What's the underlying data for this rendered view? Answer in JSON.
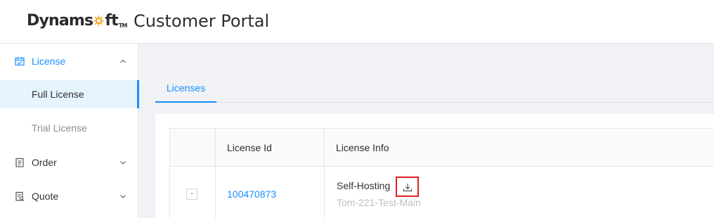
{
  "header": {
    "logo_text_before": "Dynam",
    "logo_text_after": "s",
    "logo_text_end": "ft",
    "logo_tm": "TM",
    "portal_title": "Customer Portal"
  },
  "sidebar": {
    "items": [
      {
        "label": "License",
        "icon": "license-icon",
        "expanded": true
      },
      {
        "label": "Full License",
        "selected": true
      },
      {
        "label": "Trial License"
      },
      {
        "label": "Order",
        "icon": "order-icon",
        "expanded": false
      },
      {
        "label": "Quote",
        "icon": "quote-icon",
        "expanded": false
      }
    ]
  },
  "tabs": [
    {
      "label": "Licenses",
      "active": true
    }
  ],
  "table": {
    "headers": [
      "",
      "License Id",
      "License Info"
    ],
    "rows": [
      {
        "expand_symbol": "-",
        "license_id": "100470873",
        "license_type": "Self-Hosting",
        "license_name": "Tom-221-Test-Main",
        "action_icon": "download-icon"
      }
    ]
  },
  "colors": {
    "accent": "#1890ff",
    "highlight_box": "#e02020",
    "logo_orange": "#f39c12"
  }
}
